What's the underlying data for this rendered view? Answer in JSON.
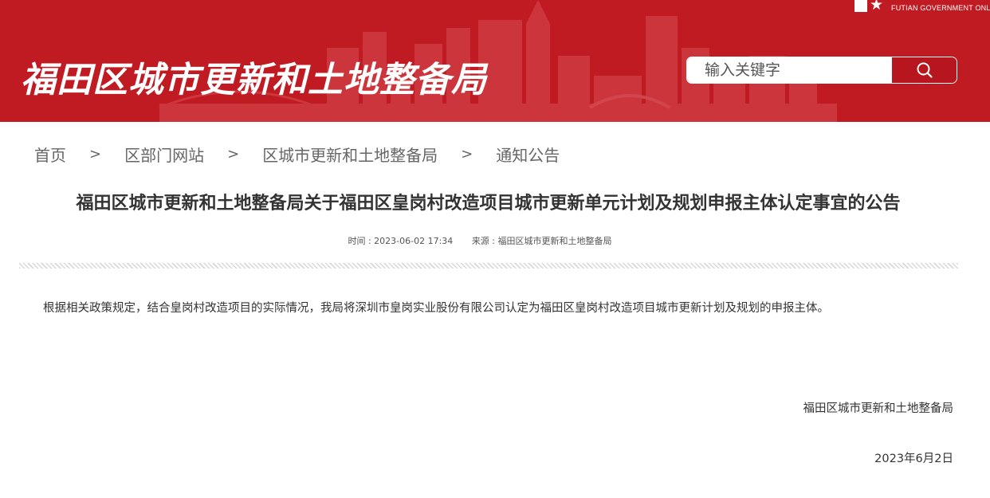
{
  "header": {
    "site_title": "福田区城市更新和土地整备局",
    "gov_logo_text": "FUTIAN GOVERNMENT ONLI",
    "colors": {
      "banner": "#c01b22",
      "search_button": "#b8161e"
    },
    "search": {
      "placeholder": "输入关键字",
      "button_icon": "search-icon"
    }
  },
  "breadcrumb": {
    "items": [
      "首页",
      "区部门网站",
      "区城市更新和土地整备局",
      "通知公告"
    ],
    "separator": ">"
  },
  "article": {
    "title": "福田区城市更新和土地整备局关于福田区皇岗村改造项目城市更新单元计划及规划申报主体认定事宜的公告",
    "time": "时间 : 2023-06-02 17:34",
    "source": "来源 : 福田区城市更新和土地整备局",
    "body": "根据相关政策规定，结合皇岗村改造项目的实际情况，我局将深圳市皇岗实业股份有限公司认定为福田区皇岗村改造项目城市更新计划及规划的申报主体。",
    "signature_org": "福田区城市更新和土地整备局",
    "signature_date": "2023年6月2日"
  }
}
